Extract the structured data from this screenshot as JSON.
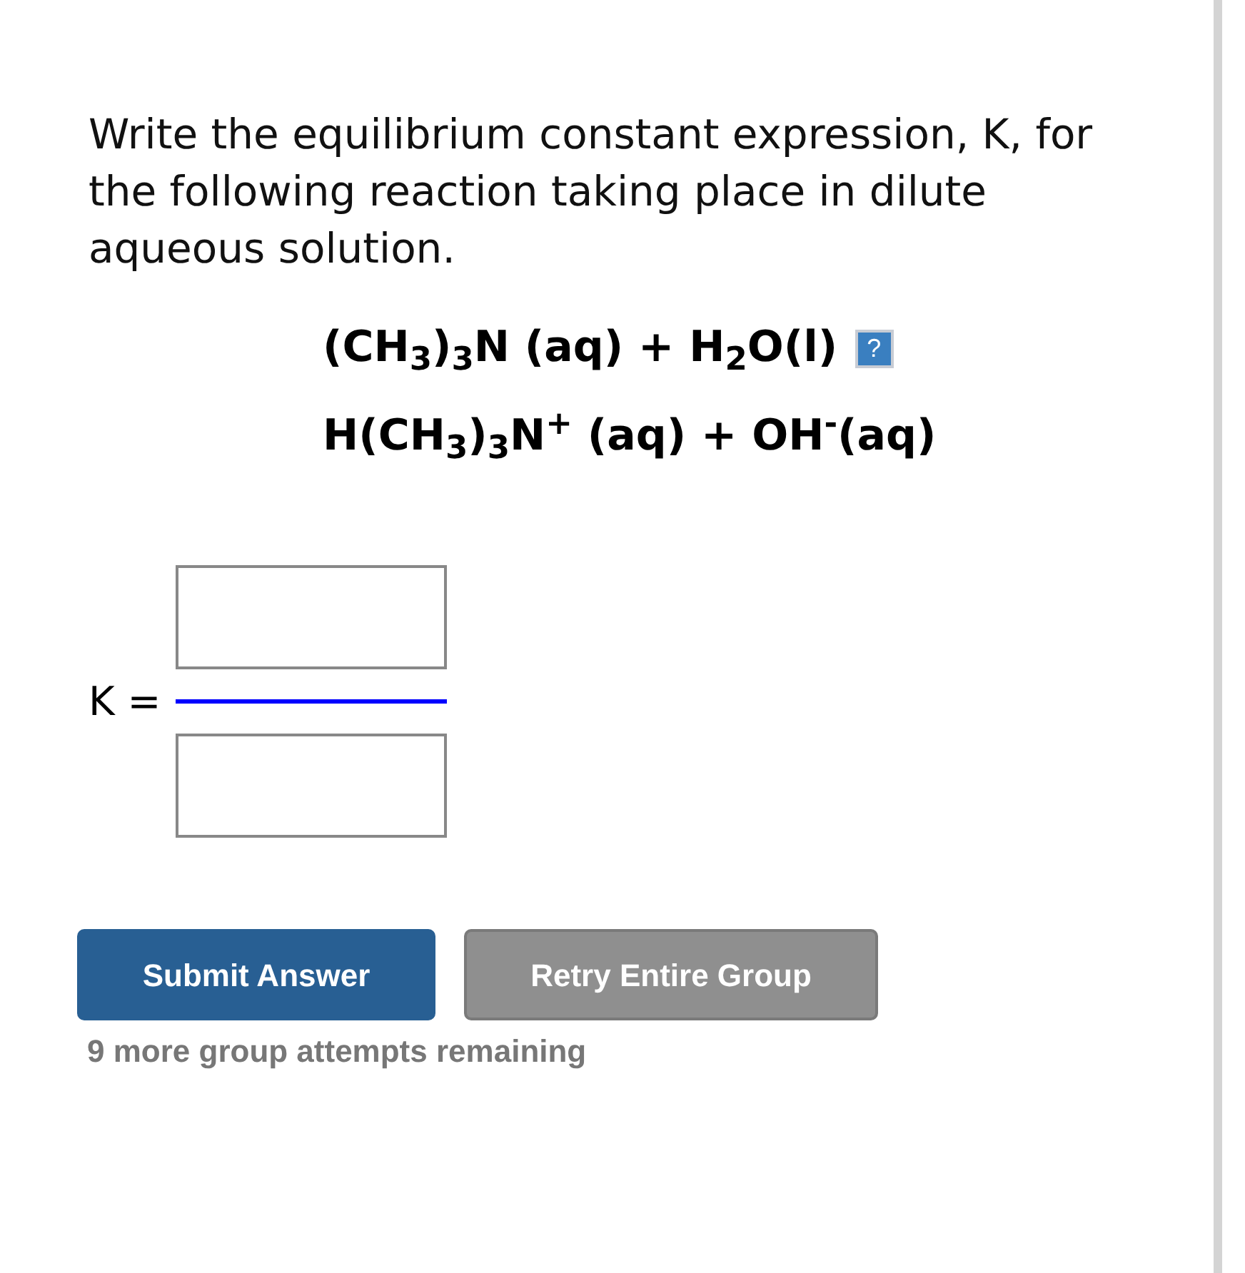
{
  "question": "Write the equilibrium constant expression, K, for the following reaction taking place in dilute aqueous solution.",
  "equation": {
    "reactants": "(CH$_{3}$)$_{3}$N (aq) + H$_{2}$O(l)",
    "help": "?",
    "products": "H(CH$_{3}$)$_{3}$N$^{+}$ (aq) + OH$^{-}$(aq)"
  },
  "answer": {
    "label": "K ="
  },
  "buttons": [
    {
      "label": "Submit Answer",
      "kind": "primary"
    },
    {
      "label": "Retry Entire Group",
      "kind": "secondary"
    }
  ],
  "attempts": "9 more group attempts remaining"
}
